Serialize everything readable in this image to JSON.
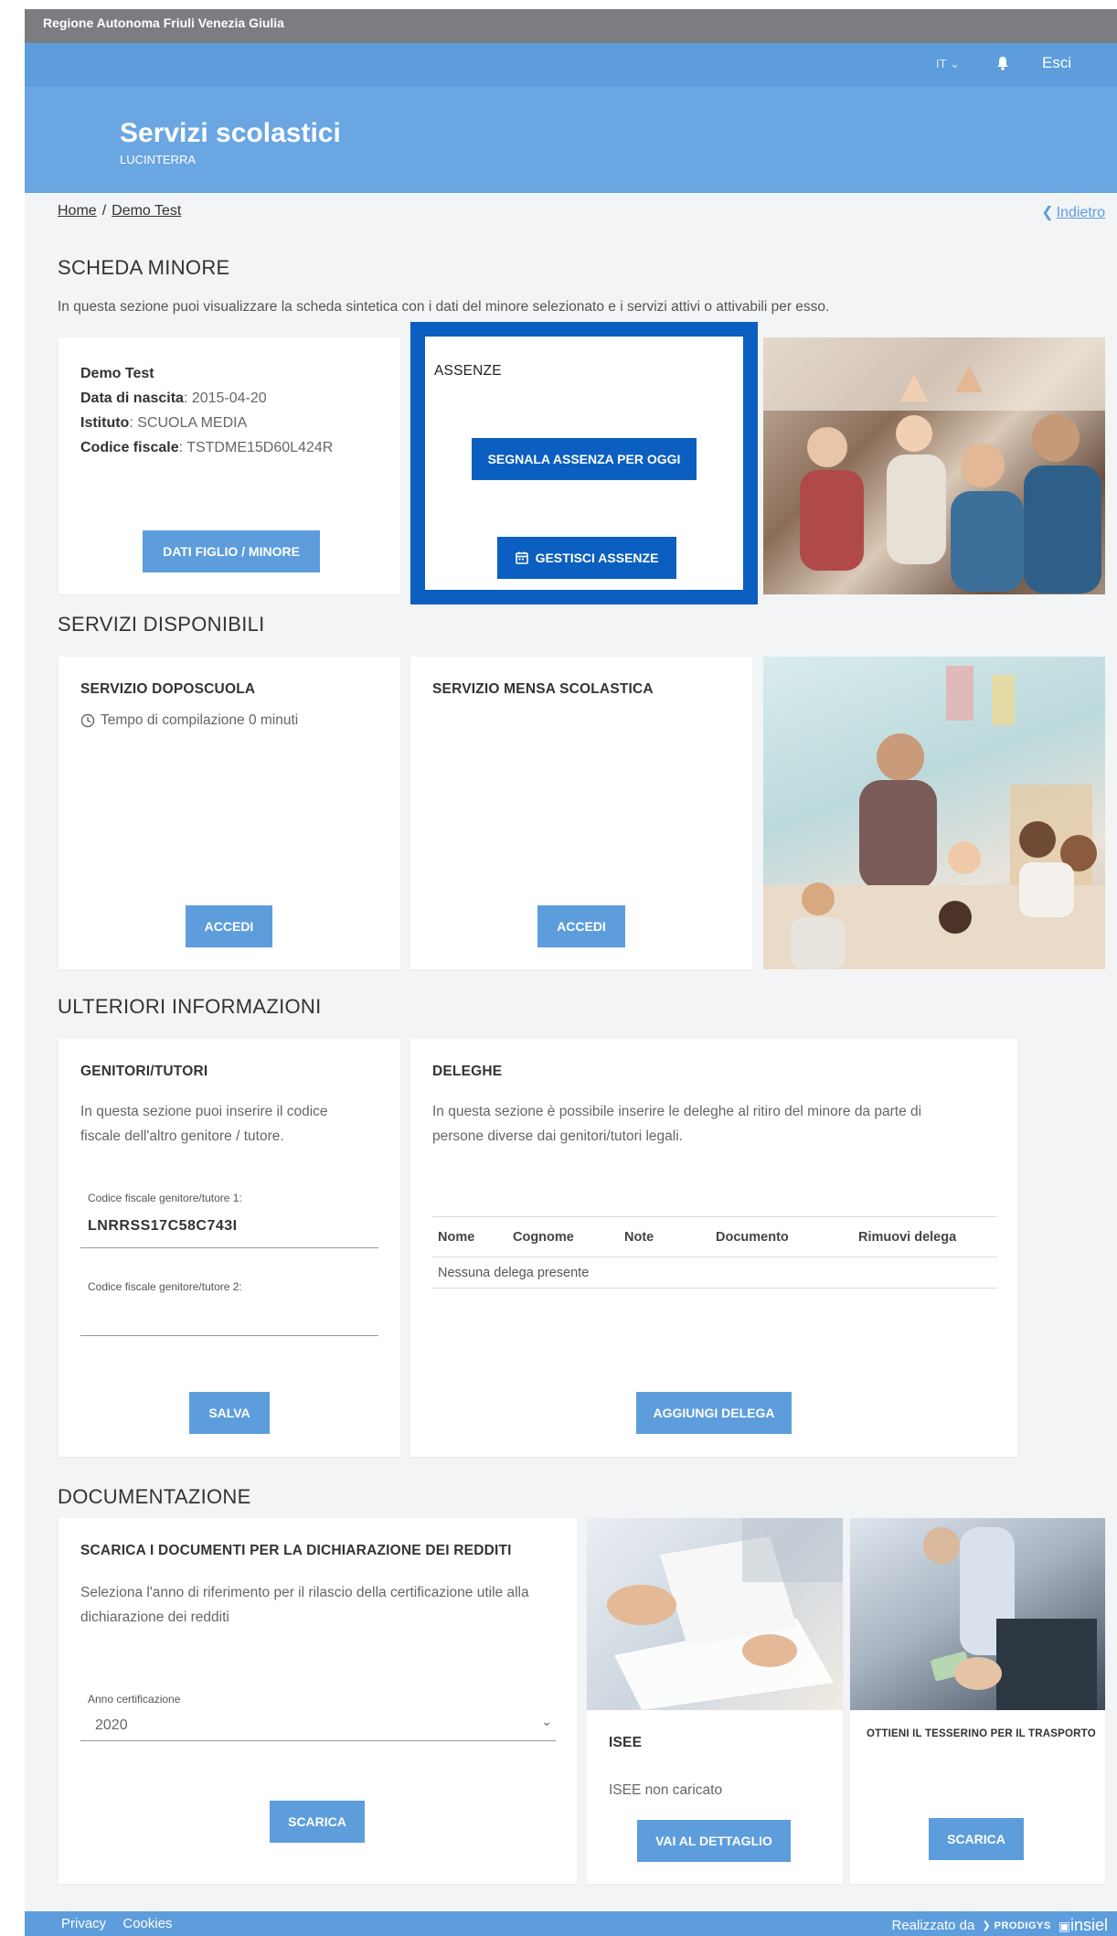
{
  "topbar": {
    "text": "Regione Autonoma Friuli Venezia Giulia"
  },
  "navbar": {
    "lang": "IT",
    "logout": "Esci"
  },
  "hero": {
    "title": "Servizi scolastici",
    "subtitle": "LUCINTERRA"
  },
  "breadcrumb": {
    "home": "Home",
    "sep": "/",
    "current": "Demo Test"
  },
  "back": {
    "label": "Indietro"
  },
  "scheda": {
    "title": "SCHEDA MINORE",
    "desc": "In questa sezione puoi visualizzare la scheda sintetica con i dati del minore selezionato e i servizi attivi o attivabili per esso.",
    "name": "Demo Test",
    "dob_label": "Data di nascita",
    "dob": ": 2015-04-20",
    "istituto_label": "Istituto",
    "istituto": ": SCUOLA MEDIA",
    "cf_label": "Codice fiscale",
    "cf": ": TSTDME15D60L424R",
    "dati_button": "DATI FIGLIO / MINORE"
  },
  "assenze": {
    "title": "ASSENZE",
    "segnala_button": "SEGNALA ASSENZA PER OGGI",
    "gestisci_button": "GESTISCI ASSENZE",
    "highlight_color": "#0b5fc0"
  },
  "servizi": {
    "title": "SERVIZI DISPONIBILI",
    "doposcuola": {
      "title": "SERVIZIO DOPOSCUOLA",
      "time": "Tempo di compilazione 0 minuti",
      "button": "ACCEDI"
    },
    "mensa": {
      "title": "SERVIZIO MENSA SCOLASTICA",
      "button": "ACCEDI"
    }
  },
  "ulteriori": {
    "title": "ULTERIORI INFORMAZIONI",
    "genitori": {
      "title": "GENITORI/TUTORI",
      "desc_line1": "In questa sezione puoi inserire il codice",
      "desc_line2": "fiscale dell'altro genitore / tutore.",
      "field1_label": "Codice fiscale genitore/tutore 1:",
      "field1_value": "LNRRSS17C58C743I",
      "field2_label": "Codice fiscale genitore/tutore 2:",
      "field2_value": "",
      "button": "SALVA"
    },
    "deleghe": {
      "title": "DELEGHE",
      "desc_line1": "In questa sezione è possibile inserire le deleghe al ritiro del minore da parte di",
      "desc_line2": "persone diverse dai genitori/tutori legali.",
      "columns": [
        "Nome",
        "Cognome",
        "Note",
        "Documento",
        "Rimuovi delega"
      ],
      "empty": "Nessuna delega presente",
      "button": "AGGIUNGI DELEGA"
    }
  },
  "documentazione": {
    "title": "DOCUMENTAZIONE",
    "redditi": {
      "title": "SCARICA I DOCUMENTI PER LA DICHIARAZIONE DEI REDDITI",
      "desc_line1": "Seleziona l'anno di riferimento per il rilascio della certificazione utile alla",
      "desc_line2": "dichiarazione dei redditi",
      "select_label": "Anno certificazione",
      "select_value": "2020",
      "button": "SCARICA"
    },
    "isee": {
      "title": "ISEE",
      "status": "ISEE non caricato",
      "button": "VAI AL DETTAGLIO"
    },
    "tesserino": {
      "title": "OTTIENI IL TESSERINO PER IL TRASPORTO",
      "button": "SCARICA"
    }
  },
  "footer": {
    "privacy": "Privacy",
    "cookies": "Cookies",
    "credits": "Realizzato da",
    "prodigys": "PRODIGYS",
    "insiel": "insiel"
  }
}
